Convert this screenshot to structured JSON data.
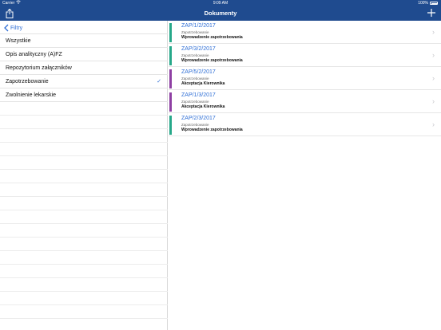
{
  "status": {
    "carrier": "Carrier",
    "time": "9:09 AM",
    "battery": "100%"
  },
  "nav": {
    "title": "Dokumenty"
  },
  "filters": {
    "back_label": "Filtry",
    "items": [
      {
        "label": "Wszystkie",
        "selected": false
      },
      {
        "label": "Opis analityczny (A)FZ",
        "selected": false
      },
      {
        "label": "Repozytorium załączników",
        "selected": false
      },
      {
        "label": "Zapotrzebowanie",
        "selected": true
      },
      {
        "label": "Zwolnienie lekarskie",
        "selected": false
      }
    ],
    "check_mark": "✓"
  },
  "documents": [
    {
      "id": "ZAP/1/2/2017",
      "type": "Zapotrzebowanie",
      "status": "Wprowadzenie zapotrzebowania",
      "color": "#26a889"
    },
    {
      "id": "ZAP/3/2/2017",
      "type": "Zapotrzebowanie",
      "status": "Wprowadzenie zapotrzebowania",
      "color": "#26a889"
    },
    {
      "id": "ZAP/5/2/2017",
      "type": "Zapotrzebowanie",
      "status": "Akceptacja Kierownika",
      "color": "#8e3fa3"
    },
    {
      "id": "ZAP/1/3/2017",
      "type": "Zapotrzebowanie",
      "status": "Akceptacja Kierownika",
      "color": "#8e3fa3"
    },
    {
      "id": "ZAP/2/3/2017",
      "type": "Zapotrzebowanie",
      "status": "Wprowadzenie zapotrzebowania",
      "color": "#26a889"
    }
  ],
  "colors": {
    "bar": "#1f4b8f",
    "accent": "#2f6fd6"
  }
}
